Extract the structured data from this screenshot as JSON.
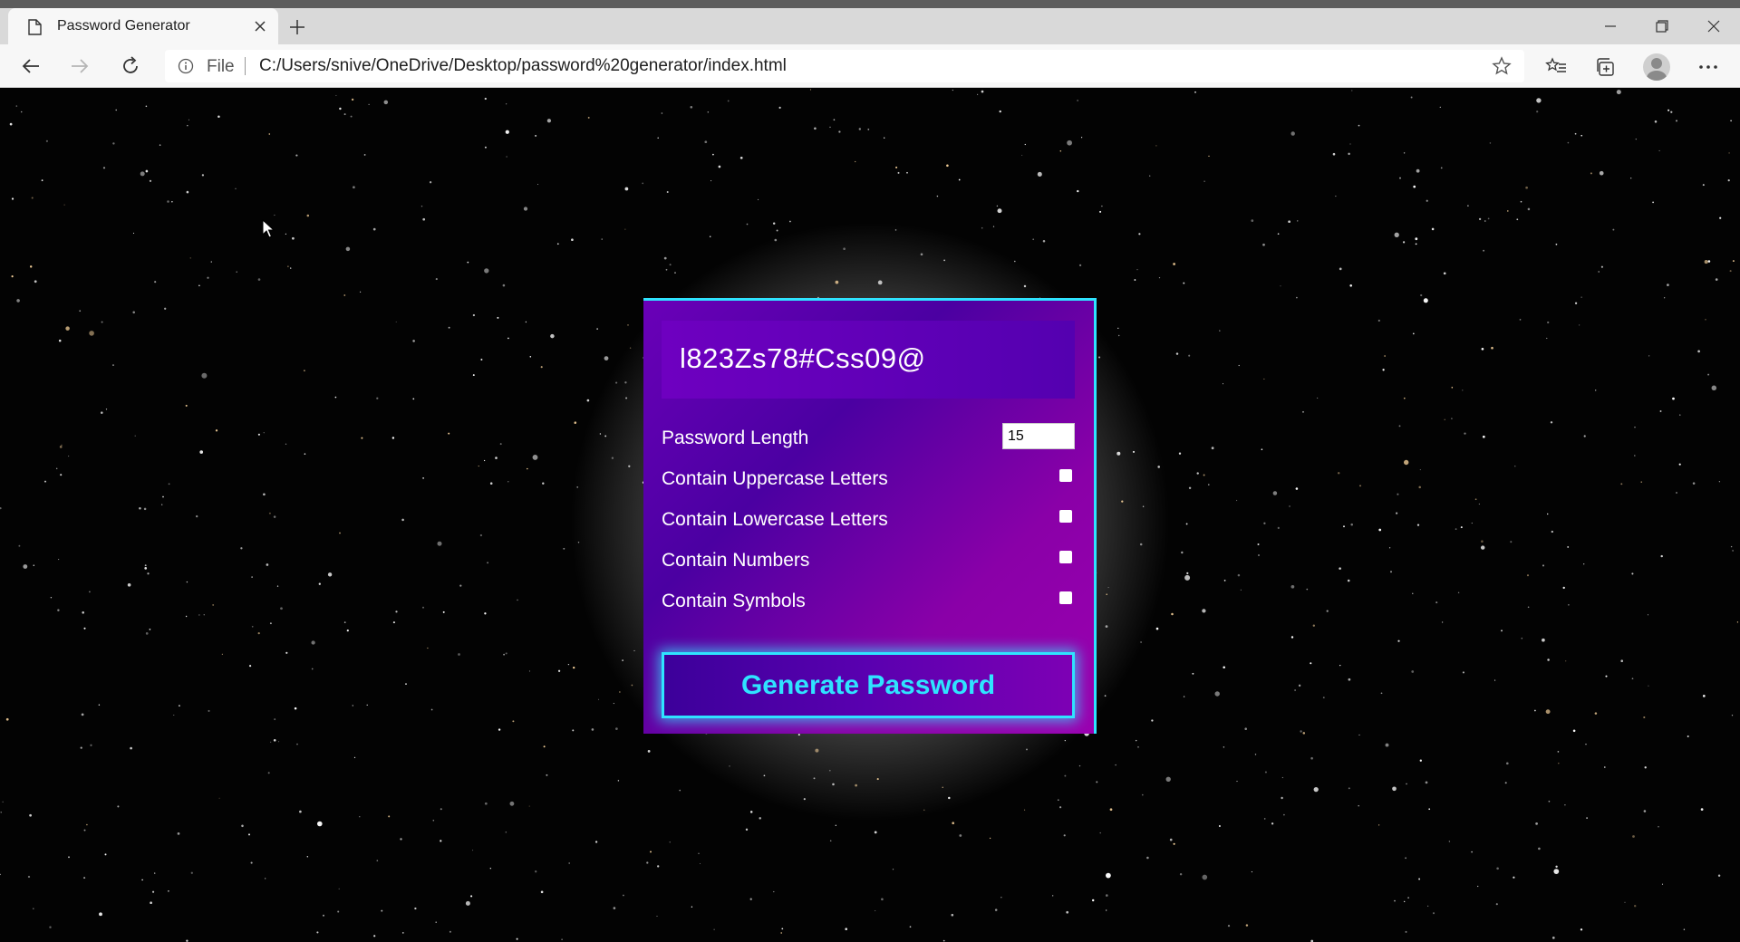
{
  "browser": {
    "tab_title": "Password Generator",
    "url_scheme": "File",
    "url": "C:/Users/snive/OneDrive/Desktop/password%20generator/index.html"
  },
  "generator": {
    "password": "l823Zs78#Css09@",
    "options": {
      "length_label": "Password Length",
      "length_value": "15",
      "uppercase_label": "Contain Uppercase Letters",
      "uppercase_checked": false,
      "lowercase_label": "Contain Lowercase Letters",
      "lowercase_checked": false,
      "numbers_label": "Contain Numbers",
      "numbers_checked": false,
      "symbols_label": "Contain Symbols",
      "symbols_checked": false
    },
    "button_label": "Generate Password"
  },
  "colors": {
    "accent": "#2fe3ff",
    "card_purple": "#6a00b8",
    "card_magenta": "#9b00b0"
  },
  "icons": {
    "tab": "page-icon",
    "close": "close-icon",
    "new_tab": "plus-icon",
    "back": "back-arrow-icon",
    "forward": "forward-arrow-icon",
    "reload": "reload-icon",
    "info": "info-icon",
    "favorite": "star-icon",
    "favorites_list": "favorites-icon",
    "collections": "collections-icon",
    "profile": "profile-avatar",
    "more": "more-icon"
  }
}
